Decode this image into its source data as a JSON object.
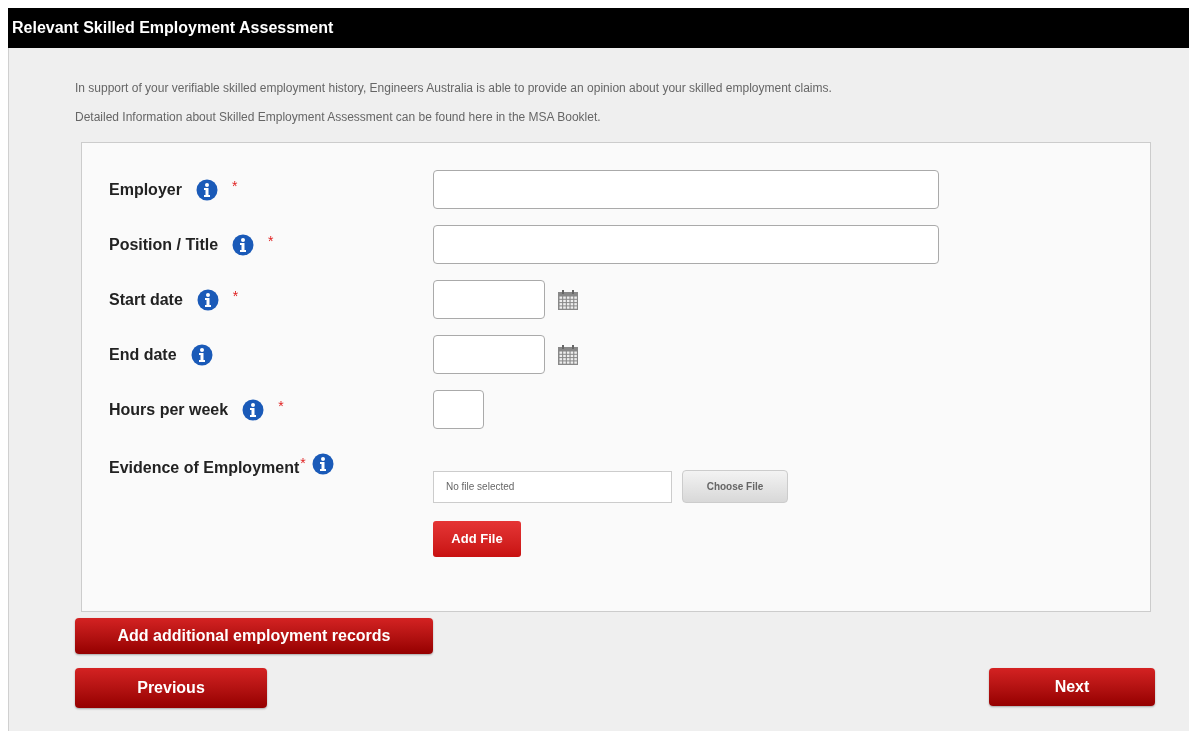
{
  "header": {
    "title": "Relevant Skilled Employment Assessment"
  },
  "intro": [
    "In support of your verifiable skilled employment history, Engineers Australia is able to provide an opinion about your skilled employment claims.",
    "Detailed Information about Skilled Employment Assessment can be found here in the MSA Booklet."
  ],
  "fields": [
    {
      "kind": "text",
      "label": "Employer",
      "required_mark": "*"
    },
    {
      "kind": "text",
      "label": "Position / Title",
      "required_mark": "*"
    },
    {
      "kind": "date",
      "label": "Start date",
      "required_mark": "*"
    },
    {
      "kind": "date",
      "label": "End date"
    },
    {
      "kind": "short",
      "label": "Hours per week",
      "required_mark": "*"
    },
    {
      "kind": "file",
      "label": "Evidence of Employment",
      "required_mark": "*",
      "file_text": "No file selected",
      "choose_label": "Choose File",
      "add_label": "Add File"
    }
  ],
  "add_records_button": "Add additional employment records",
  "previous_button": "Previous",
  "next_button": "Next"
}
